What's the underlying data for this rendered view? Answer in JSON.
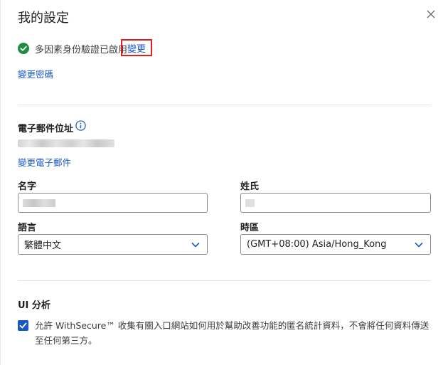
{
  "dialog": {
    "title": "我的設定"
  },
  "security": {
    "mfa_status": "多因素身份驗證已啟用",
    "change_link": "變更",
    "change_password_link": "變更密碼"
  },
  "email_section": {
    "label": "電子郵件位址",
    "change_email_link": "變更電子郵件"
  },
  "profile": {
    "first_name_label": "名字",
    "last_name_label": "姓氏",
    "language_label": "語言",
    "language_value": "繁體中文",
    "timezone_label": "時區",
    "timezone_value": "(GMT+08:00) Asia/Hong_Kong"
  },
  "analytics": {
    "heading": "UI 分析",
    "consent_text": "允許 WithSecure™ 收集有關入口網站如何用於幫助改善功能的匿名統計資料，不會將任何資料傳送至任何第三方。",
    "consent_checked": true
  },
  "colors": {
    "accent": "#1a57c7",
    "success": "#1e8e3e",
    "highlight_border": "#e0201b"
  },
  "icons": [
    "close-icon",
    "check-circle-icon",
    "info-icon",
    "chevron-down-icon",
    "checkmark-icon"
  ]
}
